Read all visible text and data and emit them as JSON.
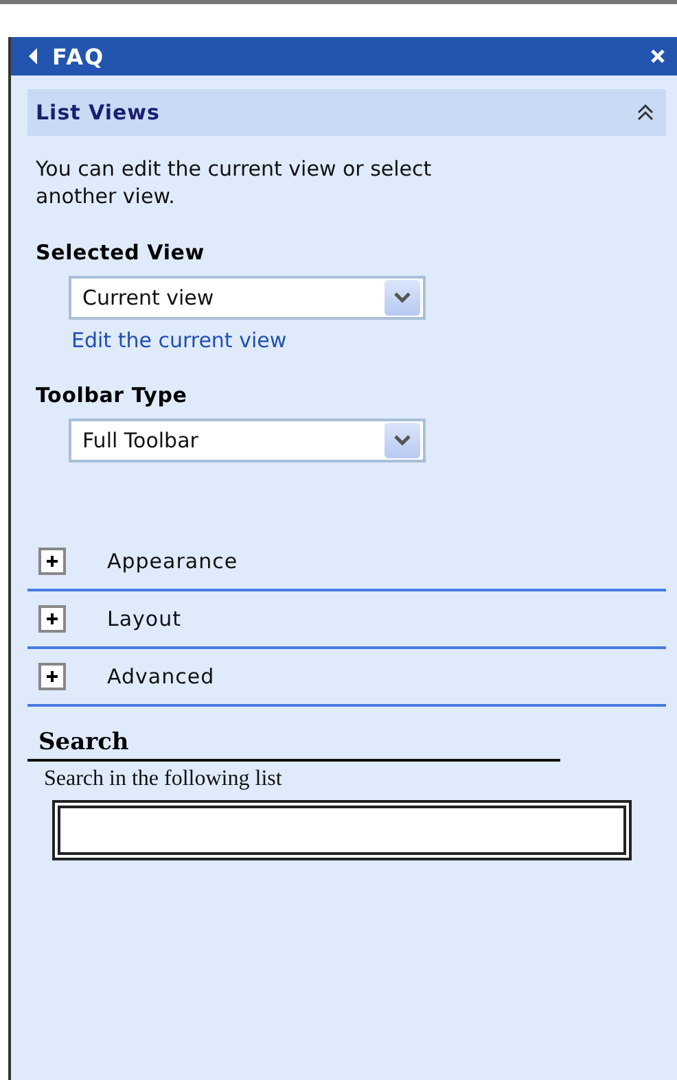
{
  "pane": {
    "title": "FAQ"
  },
  "list_views": {
    "title": "List Views",
    "expanded": true,
    "description": "You can edit the current view or select another view.",
    "selected_view": {
      "label": "Selected View",
      "value": "Current view",
      "link": "Edit the current view"
    },
    "toolbar_type": {
      "label": "Toolbar Type",
      "value": "Full Toolbar"
    }
  },
  "sections": [
    {
      "label": "Appearance",
      "expanded": false
    },
    {
      "label": "Layout",
      "expanded": false
    },
    {
      "label": "Advanced",
      "expanded": false
    }
  ],
  "search": {
    "title": "Search",
    "hint": "Search in the following list"
  }
}
